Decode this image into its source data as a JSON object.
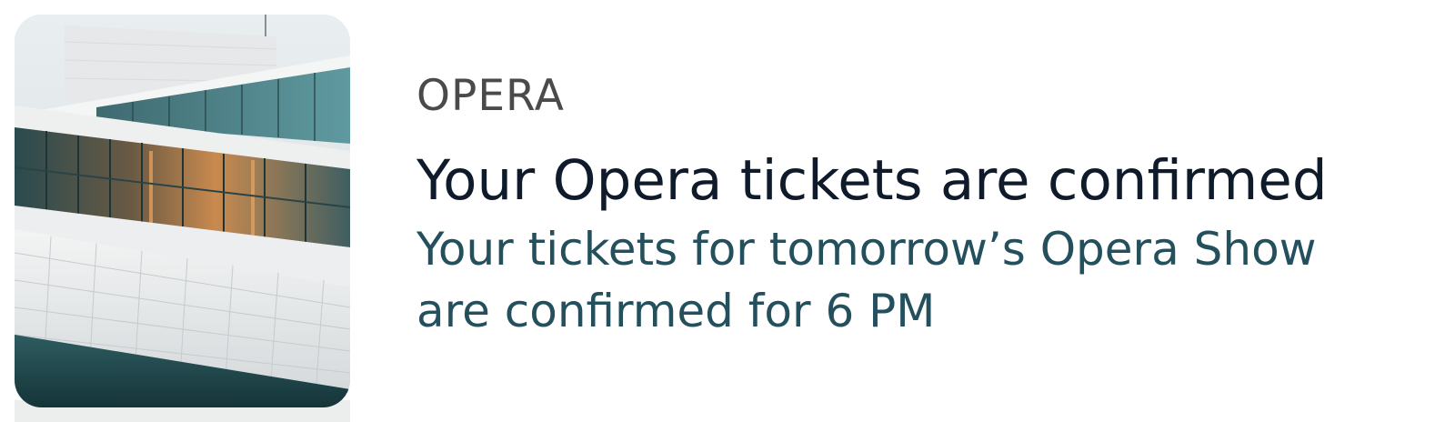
{
  "notification": {
    "category": "OPERA",
    "title": "Your Opera tickets are confirmed",
    "body": "Your tickets for tomorrow’s Opera Show are confirmed for 6 PM"
  },
  "image": {
    "subject": "opera-house-photo"
  },
  "colors": {
    "category": "#4a4a4a",
    "title": "#0f1a2b",
    "body": "#24505e"
  }
}
